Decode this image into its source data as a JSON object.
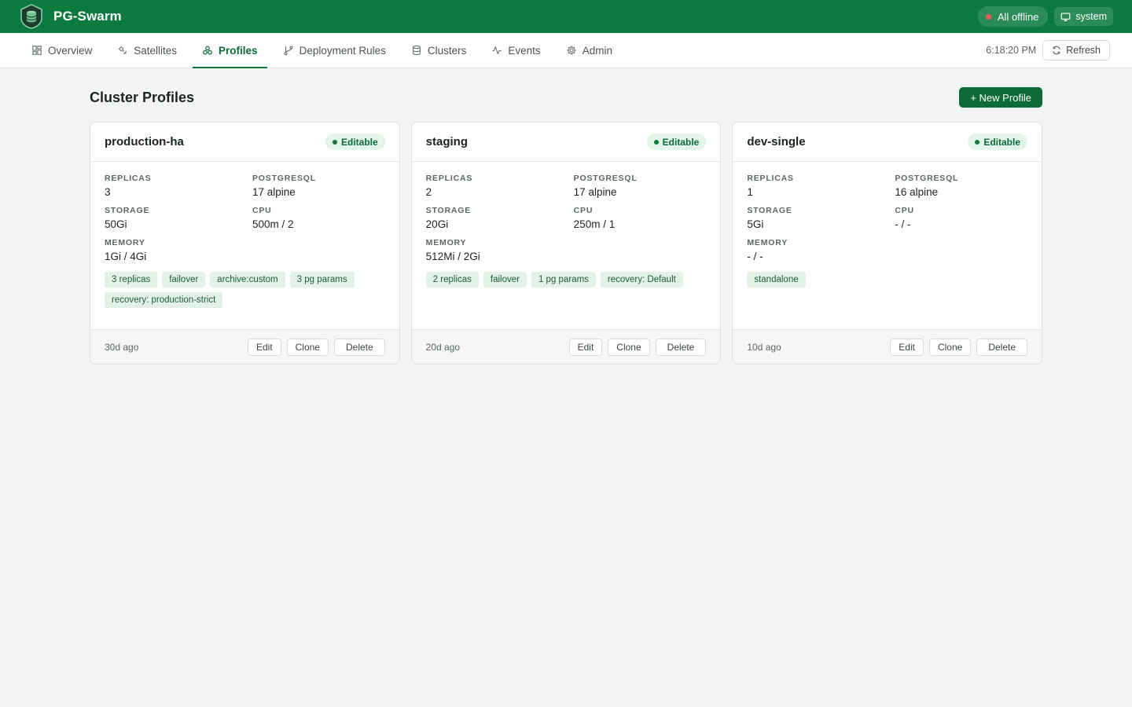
{
  "app": {
    "title": "PG-Swarm"
  },
  "top": {
    "status_label": "All offline",
    "user_label": "system"
  },
  "nav": {
    "tabs": [
      {
        "label": "Overview",
        "icon": "grid-icon"
      },
      {
        "label": "Satellites",
        "icon": "satellite-icon"
      },
      {
        "label": "Profiles",
        "icon": "profiles-icon",
        "active": true
      },
      {
        "label": "Deployment Rules",
        "icon": "git-branch-icon"
      },
      {
        "label": "Clusters",
        "icon": "database-icon"
      },
      {
        "label": "Events",
        "icon": "activity-icon"
      },
      {
        "label": "Admin",
        "icon": "gear-icon"
      }
    ],
    "clock": "6:18:20 PM",
    "refresh_label": "Refresh"
  },
  "page": {
    "title": "Cluster Profiles",
    "new_button": "+ New Profile"
  },
  "labels": {
    "replicas": "REPLICAS",
    "postgresql": "POSTGRESQL",
    "storage": "STORAGE",
    "cpu": "CPU",
    "memory": "MEMORY"
  },
  "actions": {
    "edit": "Edit",
    "clone": "Clone",
    "delete": "Delete"
  },
  "profiles": [
    {
      "name": "production-ha",
      "badge": "Editable",
      "replicas": "3",
      "postgresql": "17 alpine",
      "storage": "50Gi",
      "cpu": "500m / 2",
      "memory": "1Gi / 4Gi",
      "tags": [
        "3 replicas",
        "failover",
        "archive:custom",
        "3 pg params",
        "recovery: production-strict"
      ],
      "age": "30d ago"
    },
    {
      "name": "staging",
      "badge": "Editable",
      "replicas": "2",
      "postgresql": "17 alpine",
      "storage": "20Gi",
      "cpu": "250m / 1",
      "memory": "512Mi / 2Gi",
      "tags": [
        "2 replicas",
        "failover",
        "1 pg params",
        "recovery: Default"
      ],
      "age": "20d ago"
    },
    {
      "name": "dev-single",
      "badge": "Editable",
      "replicas": "1",
      "postgresql": "16 alpine",
      "storage": "5Gi",
      "cpu": "- / -",
      "memory": "- / -",
      "tags": [
        "standalone"
      ],
      "age": "10d ago"
    }
  ],
  "colors": {
    "brand": "#0a7a3e",
    "offline": "#ef5a5a",
    "badge_bg": "#e3f4e8"
  }
}
